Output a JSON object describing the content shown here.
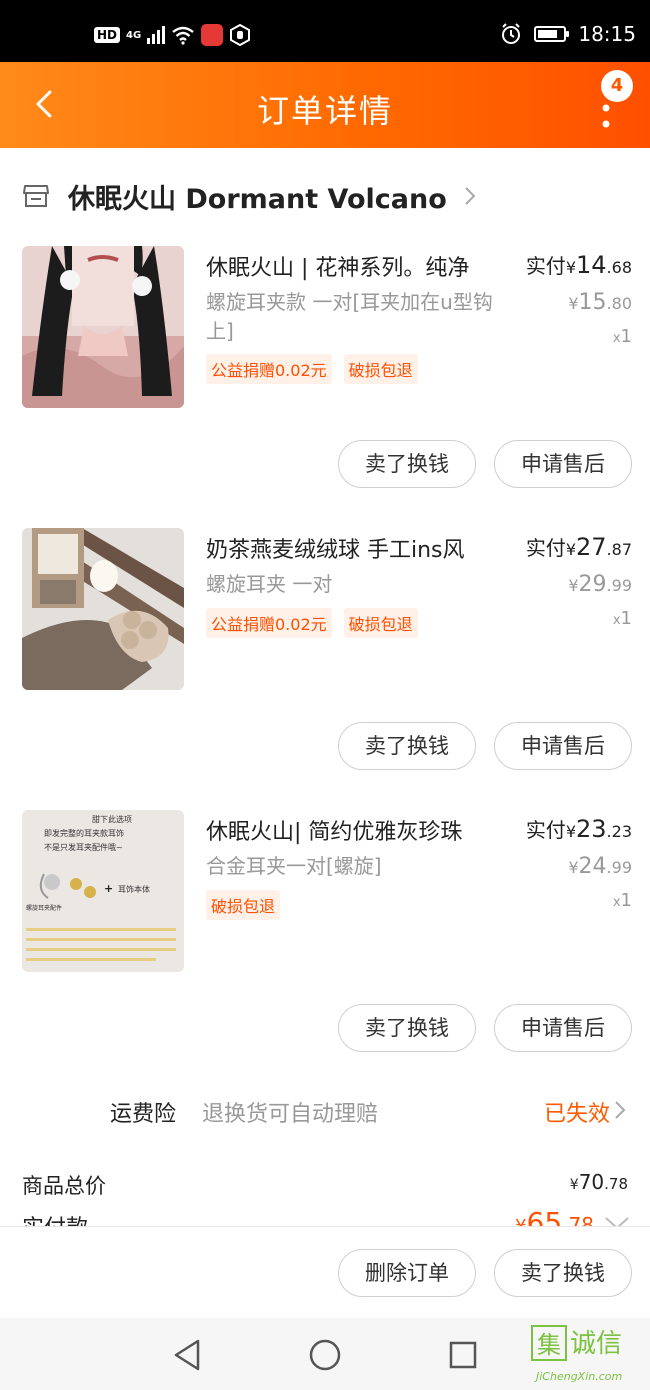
{
  "status_bar": {
    "network_badge": "HD",
    "network_type": "4G",
    "time": "18:15",
    "battery_level": 0.8,
    "icons": [
      "hd-icon",
      "signal-icon",
      "wifi-icon",
      "app-notification-icon",
      "hand-icon",
      "alarm-icon",
      "battery-icon"
    ]
  },
  "header": {
    "title": "订单详情",
    "back_icon": "chevron-left-icon",
    "more_icon": "more-vertical-icon",
    "badge_count": "4"
  },
  "shop": {
    "name": "休眠火山 Dormant Volcano",
    "icon": "store-icon"
  },
  "items": [
    {
      "title": "休眠火山 | 花神系列。纯净",
      "sku": "螺旋耳夹款 一对[耳夹加在u型钩上]",
      "tags": [
        "公益捐赠0.02元",
        "破损包退"
      ],
      "paid_label": "实付",
      "currency": "¥",
      "paid_int": "14",
      "paid_dec": ".68",
      "orig_int": "15",
      "orig_dec": ".80",
      "qty_x": "x",
      "qty": "1",
      "btn_sell": "卖了换钱",
      "btn_after_sale": "申请售后"
    },
    {
      "title": "奶茶燕麦绒绒球 手工ins风",
      "sku": "螺旋耳夹  一对",
      "tags": [
        "公益捐赠0.02元",
        "破损包退"
      ],
      "paid_label": "实付",
      "currency": "¥",
      "paid_int": "27",
      "paid_dec": ".87",
      "orig_int": "29",
      "orig_dec": ".99",
      "qty_x": "x",
      "qty": "1",
      "btn_sell": "卖了换钱",
      "btn_after_sale": "申请售后"
    },
    {
      "title": "休眠火山|  简约优雅灰珍珠",
      "sku": "合金耳夹一对[螺旋]",
      "tags": [
        "破损包退"
      ],
      "paid_label": "实付",
      "currency": "¥",
      "paid_int": "23",
      "paid_dec": ".23",
      "orig_int": "24",
      "orig_dec": ".99",
      "qty_x": "x",
      "qty": "1",
      "btn_sell": "卖了换钱",
      "btn_after_sale": "申请售后",
      "image_caption_lines": [
        "甜下此选项",
        "即发完整的耳夹款耳饰",
        "不是只发耳夹配件哦~",
        "螺旋耳夹配件",
        "耳饰本体"
      ]
    }
  ],
  "insurance": {
    "label": "运费险",
    "desc": "退换货可自动理赔",
    "status": "已失效"
  },
  "summary": {
    "total_label": "商品总价",
    "currency": "¥",
    "total_int": "70",
    "total_dec": ".78",
    "paid_label": "实付款",
    "paid_int": "65",
    "paid_dec": ".78"
  },
  "bottom_bar": {
    "delete_label": "删除订单",
    "sell_label": "卖了换钱"
  },
  "system_nav": {
    "icons": [
      "back-triangle-icon",
      "home-circle-icon",
      "recents-square-icon"
    ]
  },
  "watermark": {
    "text": "诚信",
    "url": "JiChengXin.com",
    "logo_char": "集"
  },
  "colors": {
    "accent": "#ff5000",
    "header_start": "#ff8a1a",
    "header_end": "#ff5000",
    "tag_bg": "#fff0e8",
    "muted": "#999999"
  }
}
